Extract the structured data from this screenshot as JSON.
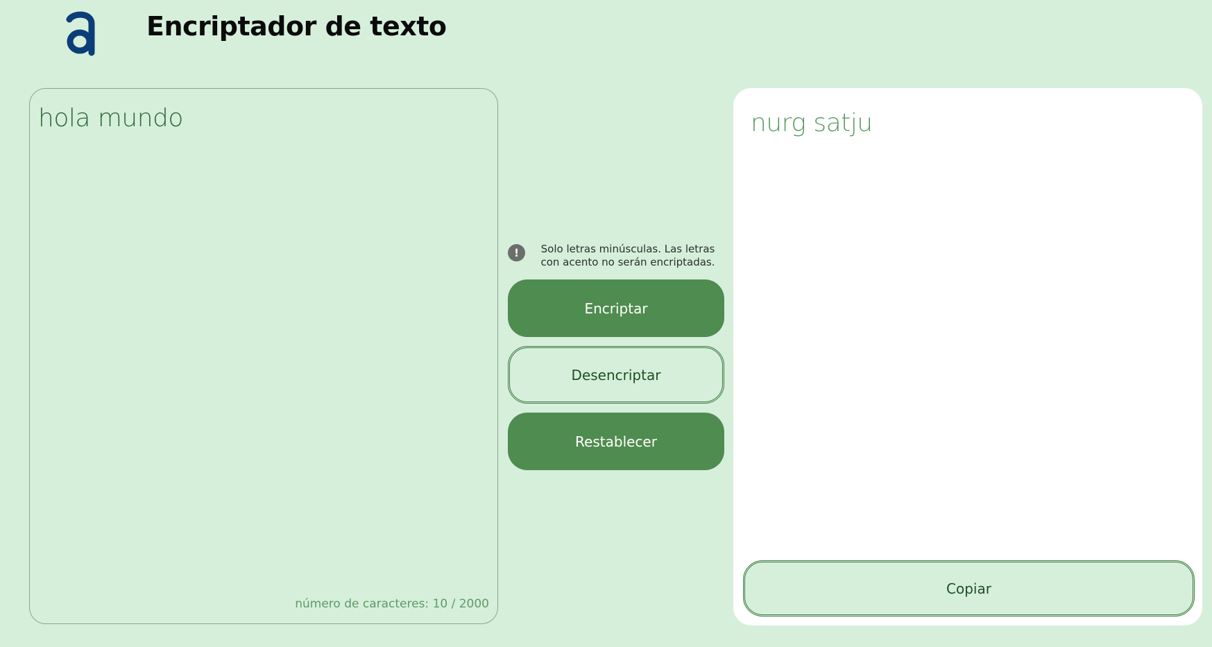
{
  "header": {
    "logo_icon": "alura-a-logo-icon",
    "logo_color": "#0b3d78",
    "title": "Encriptador de texto"
  },
  "input": {
    "value": "hola mundo",
    "char_count_label": "número de caracteres: 10 / 2000"
  },
  "notice": {
    "icon": "exclamation-circle-icon",
    "text": "Solo letras minúsculas. Las letras con acento no serán encriptadas."
  },
  "actions": {
    "encrypt_label": "Encriptar",
    "decrypt_label": "Desencriptar",
    "reset_label": "Restablecer"
  },
  "output": {
    "value": "nurg satju",
    "copy_label": "Copiar"
  },
  "colors": {
    "background": "#d6efdb",
    "primary": "#4f8c4f",
    "panel": "#ffffff",
    "text_green": "#2f6a35"
  }
}
